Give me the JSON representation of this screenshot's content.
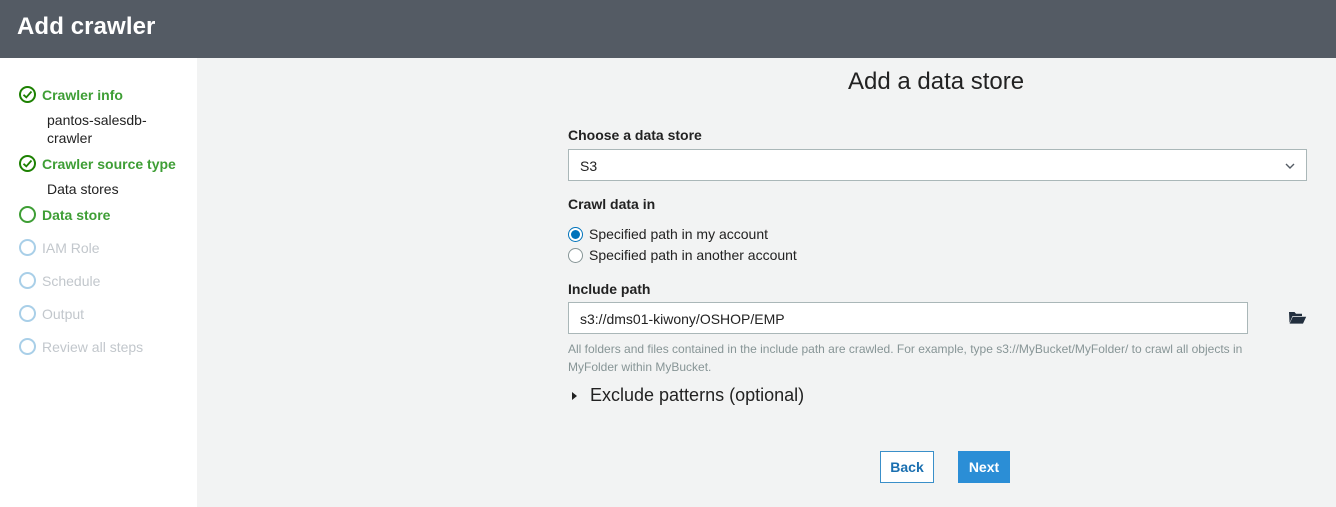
{
  "header": {
    "title": "Add crawler"
  },
  "sidebar": {
    "steps": [
      {
        "label": "Crawler info",
        "state": "done",
        "sub": [
          "pantos-salesdb-",
          "crawler"
        ]
      },
      {
        "label": "Crawler source type",
        "state": "done",
        "sub": [
          "Data stores"
        ]
      },
      {
        "label": "Data store",
        "state": "current"
      },
      {
        "label": "IAM Role",
        "state": "pending"
      },
      {
        "label": "Schedule",
        "state": "pending"
      },
      {
        "label": "Output",
        "state": "pending"
      },
      {
        "label": "Review all steps",
        "state": "pending"
      }
    ]
  },
  "main": {
    "title": "Add a data store",
    "data_store": {
      "label": "Choose a data store",
      "value": "S3"
    },
    "crawl": {
      "label": "Crawl data in",
      "options": [
        {
          "label": "Specified path in my account",
          "selected": true
        },
        {
          "label": "Specified path in another account",
          "selected": false
        }
      ]
    },
    "include_path": {
      "label": "Include path",
      "value": "s3://dms01-kiwony/OSHOP/EMP",
      "help_line1": "All folders and files contained in the include path are crawled. For example, type s3://MyBucket/MyFolder/ to crawl all objects in",
      "help_line2": "MyFolder within MyBucket."
    },
    "exclude": {
      "label": "Exclude patterns (optional)"
    },
    "buttons": {
      "back": "Back",
      "next": "Next"
    }
  },
  "colors": {
    "header_bg": "#545b64",
    "done_green": "#3e9e35",
    "primary_blue": "#2b8ed6",
    "pending_circle": "#a9cfe8"
  },
  "icons": {
    "done": "check-circle-icon",
    "current": "circle-icon",
    "pending": "circle-icon",
    "browse": "folder-open-icon",
    "select": "chevron-down-icon",
    "expand": "caret-right-icon"
  }
}
